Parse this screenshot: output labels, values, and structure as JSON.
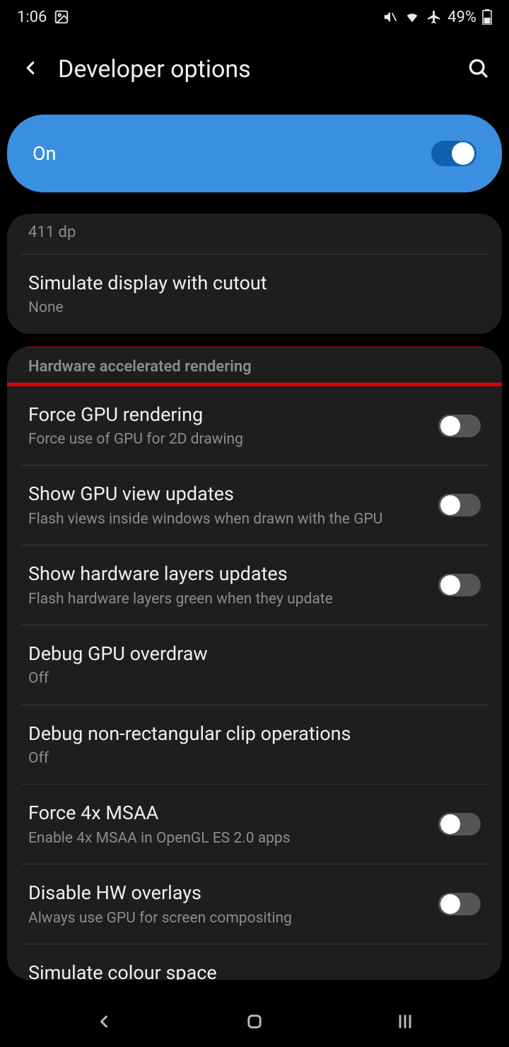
{
  "status": {
    "time": "1:06",
    "battery": "49%"
  },
  "header": {
    "title": "Developer options"
  },
  "master": {
    "label": "On",
    "enabled": true
  },
  "card1": {
    "partial_top": "411 dp",
    "item1": {
      "title": "Simulate display with cutout",
      "sub": "None"
    }
  },
  "section_header": "Hardware accelerated rendering",
  "items": [
    {
      "title": "Force GPU rendering",
      "sub": "Force use of GPU for 2D drawing",
      "toggle": false
    },
    {
      "title": "Show GPU view updates",
      "sub": "Flash views inside windows when drawn with the GPU",
      "toggle": false
    },
    {
      "title": "Show hardware layers updates",
      "sub": "Flash hardware layers green when they update",
      "toggle": false
    },
    {
      "title": "Debug GPU overdraw",
      "sub": "Off",
      "toggle": null
    },
    {
      "title": "Debug non-rectangular clip operations",
      "sub": "Off",
      "toggle": null
    },
    {
      "title": "Force 4x MSAA",
      "sub": "Enable 4x MSAA in OpenGL ES 2.0 apps",
      "toggle": false
    },
    {
      "title": "Disable HW overlays",
      "sub": "Always use GPU for screen compositing",
      "toggle": false
    }
  ],
  "cutoff_item": {
    "title": "Simulate colour space"
  }
}
